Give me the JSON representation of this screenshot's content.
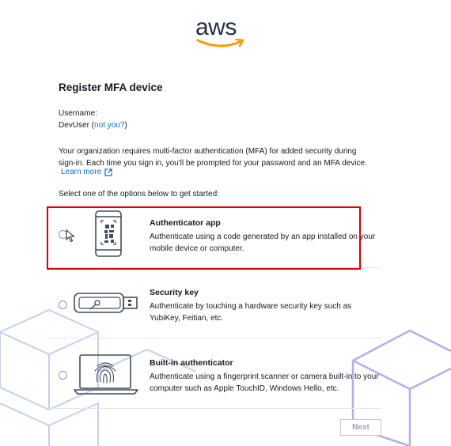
{
  "brand": {
    "logo_text": "aws",
    "accent_color": "#ff9900"
  },
  "page": {
    "title": "Register MFA device",
    "username_label": "Username:",
    "username_value": "DevUser",
    "not_you_open": " (",
    "not_you_link": "not you?",
    "not_you_close": ")",
    "intro": "Your organization requires multi-factor authentication (MFA) for added security during sign-in. Each time you sign in, you'll be prompted for your password and an MFA device.",
    "learn_more": "Learn more",
    "select_prompt": "Select one of the options below to get started:"
  },
  "options": [
    {
      "title": "Authenticator app",
      "description": "Authenticate using a code generated by an app installed on your mobile device or computer.",
      "icon": "phone-qr-icon",
      "selected": false,
      "highlighted": true
    },
    {
      "title": "Security key",
      "description": "Authenticate by touching a hardware security key such as YubiKey, Feitian, etc.",
      "icon": "usb-key-icon",
      "selected": false
    },
    {
      "title": "Built-in authenticator",
      "description": "Authenticate using a fingerprint scanner or camera built-in to your computer such as Apple TouchID, Windows Hello, etc.",
      "icon": "laptop-fingerprint-icon",
      "selected": false
    }
  ],
  "footer": {
    "next_label": "Next",
    "next_enabled": false
  },
  "colors": {
    "highlight": "#e00000",
    "link": "#0972d3",
    "cube_stroke": "#8f8fdf"
  }
}
